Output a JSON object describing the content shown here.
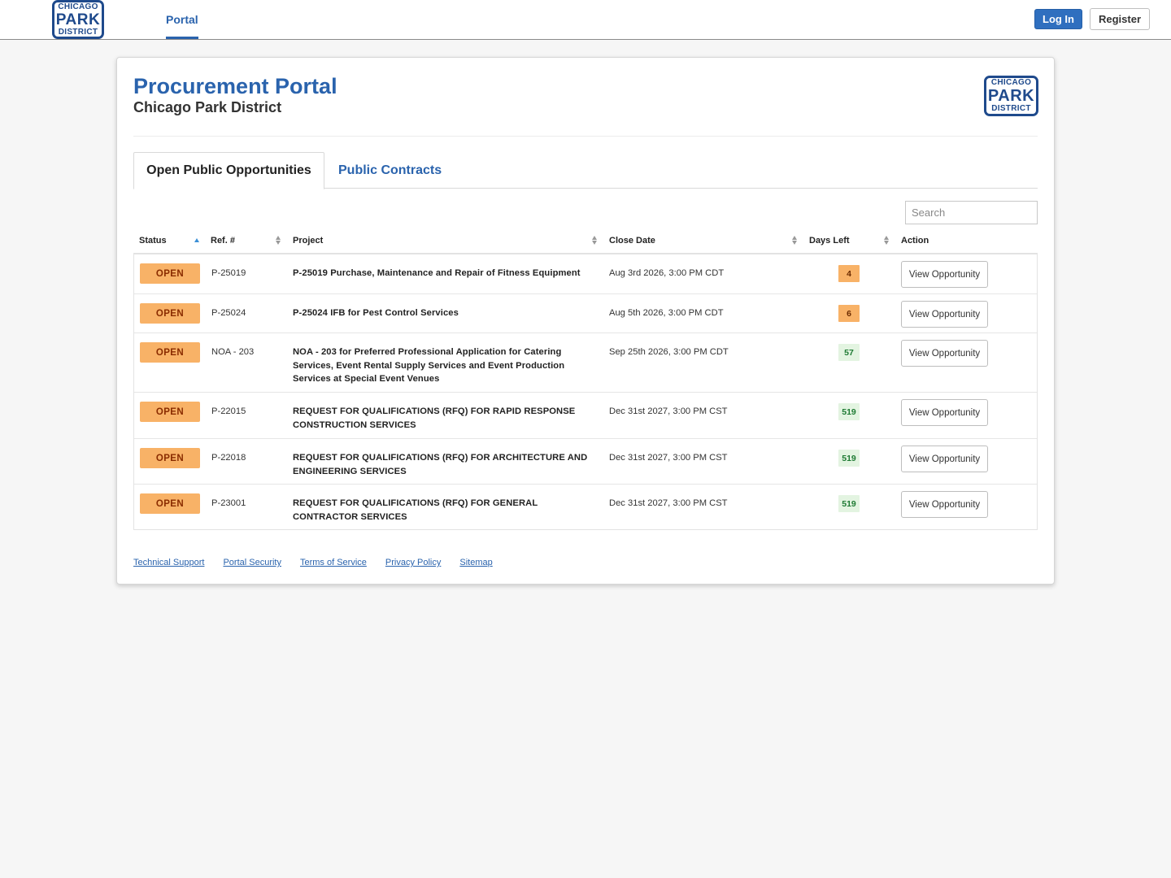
{
  "nav": {
    "logo": {
      "line1": "CHICAGO",
      "line2": "PARK",
      "line3": "DISTRICT"
    },
    "portal_label": "Portal",
    "login_label": "Log In",
    "register_label": "Register"
  },
  "header": {
    "title": "Procurement Portal",
    "subtitle": "Chicago Park District",
    "logo": {
      "line1": "CHICAGO",
      "line2": "PARK",
      "line3": "DISTRICT"
    }
  },
  "tabs": [
    {
      "label": "Open Public Opportunities",
      "active": true
    },
    {
      "label": "Public Contracts",
      "active": false
    }
  ],
  "search": {
    "placeholder": "Search",
    "value": ""
  },
  "table": {
    "columns": {
      "status": "Status",
      "ref": "Ref. #",
      "project": "Project",
      "close_date": "Close Date",
      "days_left": "Days Left",
      "action": "Action"
    },
    "sort": {
      "column": "status",
      "direction": "ascending"
    },
    "rows": [
      {
        "status": "OPEN",
        "ref": "P-25019",
        "project": "P-25019 Purchase, Maintenance and Repair of Fitness Equipment",
        "close_date": "Aug 3rd 2026, 3:00 PM CDT",
        "days_left": "4",
        "days_level": "warn",
        "action": "View Opportunity"
      },
      {
        "status": "OPEN",
        "ref": "P-25024",
        "project": "P-25024 IFB for Pest Control Services",
        "close_date": "Aug 5th 2026, 3:00 PM CDT",
        "days_left": "6",
        "days_level": "warn",
        "action": "View Opportunity"
      },
      {
        "status": "OPEN",
        "ref": "NOA - 203",
        "project": "NOA - 203 for Preferred Professional Application for Catering Services, Event Rental Supply Services and Event Production Services at Special Event Venues",
        "close_date": "Sep 25th 2026, 3:00 PM CDT",
        "days_left": "57",
        "days_level": "ok",
        "action": "View Opportunity"
      },
      {
        "status": "OPEN",
        "ref": "P-22015",
        "project": "REQUEST FOR QUALIFICATIONS (RFQ) FOR RAPID RESPONSE CONSTRUCTION SERVICES",
        "close_date": "Dec 31st 2027, 3:00 PM CST",
        "days_left": "519",
        "days_level": "ok",
        "action": "View Opportunity"
      },
      {
        "status": "OPEN",
        "ref": "P-22018",
        "project": "REQUEST FOR QUALIFICATIONS (RFQ) FOR ARCHITECTURE AND ENGINEERING SERVICES",
        "close_date": "Dec 31st 2027, 3:00 PM CST",
        "days_left": "519",
        "days_level": "ok",
        "action": "View Opportunity"
      },
      {
        "status": "OPEN",
        "ref": "P-23001",
        "project": "REQUEST FOR QUALIFICATIONS (RFQ) FOR GENERAL CONTRACTOR SERVICES",
        "close_date": "Dec 31st 2027, 3:00 PM CST",
        "days_left": "519",
        "days_level": "ok",
        "action": "View Opportunity"
      }
    ]
  },
  "footer": {
    "links": [
      "Technical Support",
      "Portal Security",
      "Terms of Service",
      "Privacy Policy",
      "Sitemap"
    ]
  },
  "colors": {
    "brand_blue": "#2a63ad",
    "logo_navy": "#1f4a8c",
    "status_orange": "#f8b267",
    "days_ok_bg": "#e3f4e1",
    "days_ok_text": "#1e7a33"
  }
}
